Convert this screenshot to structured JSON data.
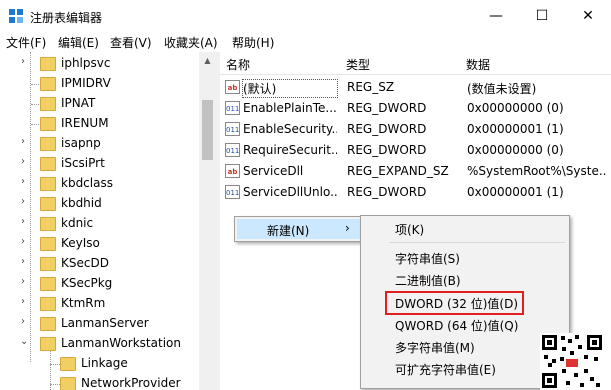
{
  "window": {
    "title": "注册表编辑器",
    "minimize": "—",
    "maximize": "☐",
    "close": "✕"
  },
  "menu": [
    "文件(F)",
    "编辑(E)",
    "查看(V)",
    "收藏夹(A)",
    "帮助(H)"
  ],
  "tree": {
    "items": [
      "iphlpsvc",
      "IPMIDRV",
      "IPNAT",
      "IRENUM",
      "isapnp",
      "iScsiPrt",
      "kbdclass",
      "kbdhid",
      "kdnic",
      "KeyIso",
      "KSecDD",
      "KSecPkg",
      "KtmRm",
      "LanmanServer",
      "LanmanWorkstation"
    ],
    "children": [
      "Linkage",
      "NetworkProvider"
    ]
  },
  "columns": {
    "name": "名称",
    "type": "类型",
    "data": "数据"
  },
  "rows": [
    {
      "icon": "ab",
      "name": "(默认)",
      "type": "REG_SZ",
      "data": "(数值未设置)"
    },
    {
      "icon": "dw",
      "name": "EnablePlainTe...",
      "type": "REG_DWORD",
      "data": "0x00000000 (0)"
    },
    {
      "icon": "dw",
      "name": "EnableSecurity...",
      "type": "REG_DWORD",
      "data": "0x00000001 (1)"
    },
    {
      "icon": "dw",
      "name": "RequireSecurit...",
      "type": "REG_DWORD",
      "data": "0x00000000 (0)"
    },
    {
      "icon": "ab",
      "name": "ServiceDll",
      "type": "REG_EXPAND_SZ",
      "data": "%SystemRoot%\\Syste..."
    },
    {
      "icon": "dw",
      "name": "ServiceDllUnlo...",
      "type": "REG_DWORD",
      "data": "0x00000001 (1)"
    }
  ],
  "context_menu": {
    "new_label": "新建(N)",
    "arrow": "›"
  },
  "submenu": {
    "key": "项(K)",
    "items": [
      "字符串值(S)",
      "二进制值(B)",
      "DWORD (32 位)值(D)",
      "QWORD (64 位)值(Q)",
      "多字符串值(M)",
      "可扩充字符串值(E)"
    ]
  }
}
